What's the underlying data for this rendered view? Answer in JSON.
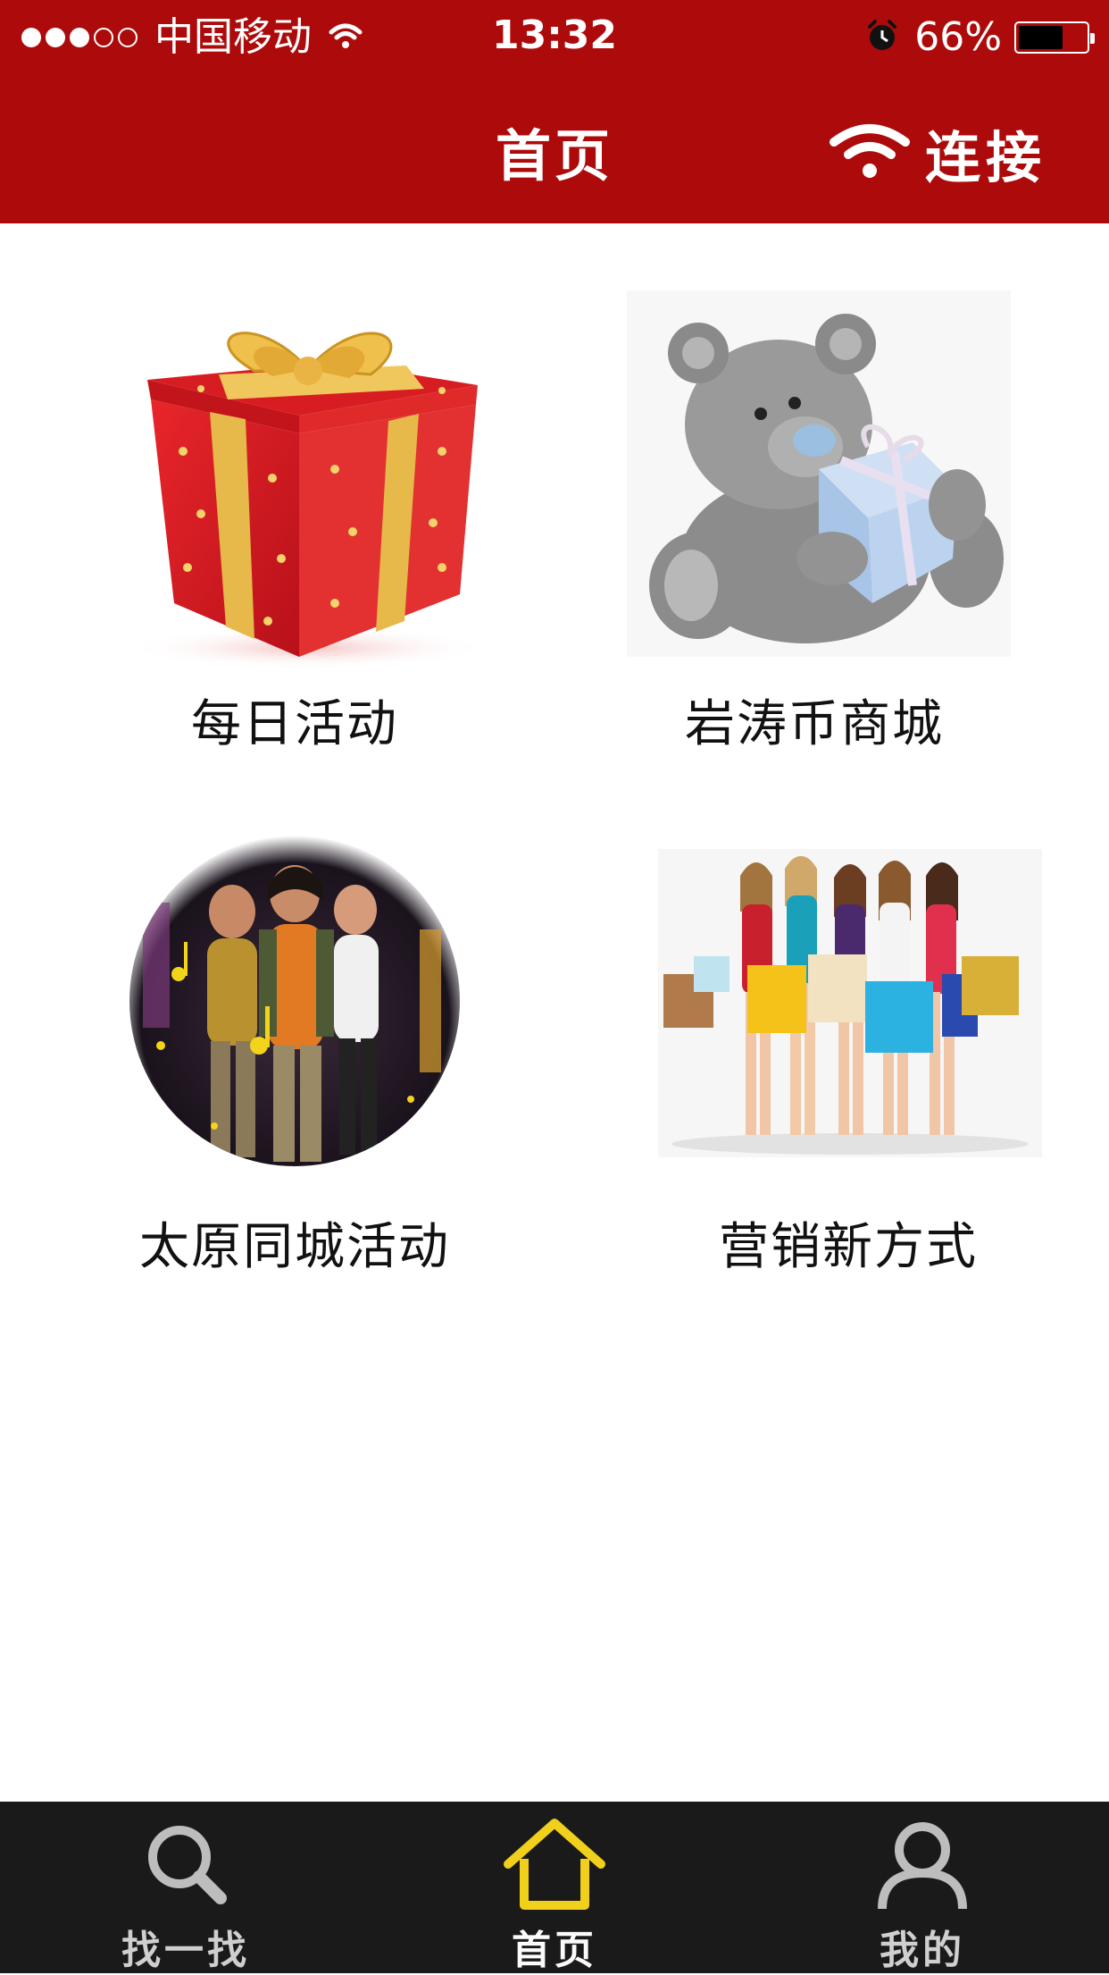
{
  "status_bar": {
    "carrier": "中国移动",
    "time": "13:32",
    "battery": "66%",
    "battery_level": 0.66,
    "signal_bars_filled": 3,
    "signal_bars_total": 5
  },
  "header": {
    "title": "首页",
    "connect_label": "连接"
  },
  "tiles": [
    {
      "label": "每日活动",
      "icon": "gift-box-image"
    },
    {
      "label": "岩涛币商城",
      "icon": "teddy-bear-image"
    },
    {
      "label": "太原同城活动",
      "icon": "concert-image"
    },
    {
      "label": "营销新方式",
      "icon": "shopping-girls-image"
    }
  ],
  "tabbar": {
    "tabs": [
      {
        "label": "找一找",
        "icon": "search-icon",
        "active": false
      },
      {
        "label": "首页",
        "icon": "home-icon",
        "active": true
      },
      {
        "label": "我的",
        "icon": "user-icon",
        "active": false
      }
    ]
  },
  "colors": {
    "header_bg": "#ad0b0b",
    "tabbar_bg": "#1a1a1a",
    "active_tab_icon": "#f0d01a"
  }
}
